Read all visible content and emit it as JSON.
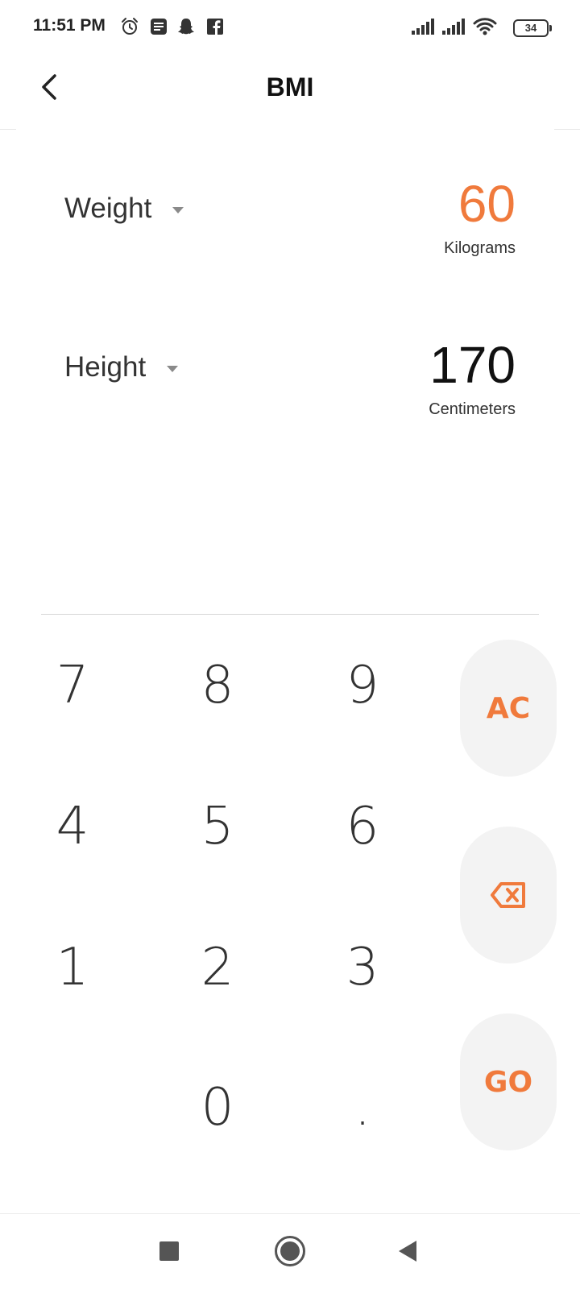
{
  "status_bar": {
    "time": "11:51 PM",
    "battery": "34",
    "left_icons": [
      "alarm-icon",
      "news-icon",
      "snapchat-icon",
      "facebook-icon"
    ],
    "right_icons": [
      "signal-icon",
      "signal-icon",
      "wifi-icon",
      "battery-icon"
    ]
  },
  "header": {
    "title": "BMI",
    "back_icon": "chevron-left-icon"
  },
  "weight": {
    "label": "Weight",
    "value": "60",
    "unit": "Kilograms",
    "value_color": "#f07a3c"
  },
  "height": {
    "label": "Height",
    "value": "170",
    "unit": "Centimeters",
    "value_color": "#111111"
  },
  "keypad": {
    "keys": [
      "7",
      "8",
      "9",
      "4",
      "5",
      "6",
      "1",
      "2",
      "3",
      "0",
      "."
    ],
    "clear_label": "AC",
    "delete_icon": "backspace-icon",
    "go_label": "GO",
    "accent_color": "#f07a3c"
  },
  "nav_bar": {
    "icons": [
      "recents-icon",
      "home-icon",
      "back-icon"
    ]
  }
}
